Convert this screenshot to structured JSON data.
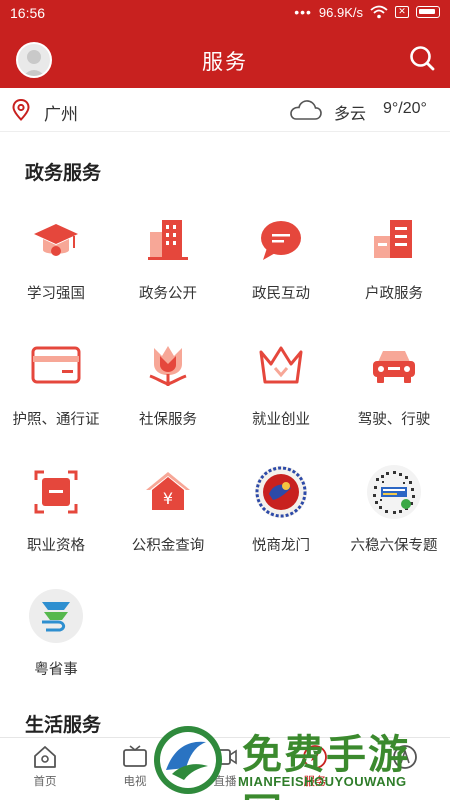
{
  "status": {
    "time": "16:56",
    "dots": "•••",
    "speed": "96.9K/s",
    "sim": "✕"
  },
  "header": {
    "title": "服务"
  },
  "location": {
    "city": "广州",
    "condition": "多云",
    "temperature": "9°/20°"
  },
  "sections": {
    "gov_title": "政务服务",
    "life_title": "生活服务"
  },
  "services": [
    {
      "label": "学习强国",
      "icon": "graduation-cap-icon"
    },
    {
      "label": "政务公开",
      "icon": "building-icon"
    },
    {
      "label": "政民互动",
      "icon": "chat-bubble-icon"
    },
    {
      "label": "户政服务",
      "icon": "houses-icon"
    },
    {
      "label": "护照、通行证",
      "icon": "passport-card-icon"
    },
    {
      "label": "社保服务",
      "icon": "tulip-icon"
    },
    {
      "label": "就业创业",
      "icon": "crown-icon"
    },
    {
      "label": "驾驶、行驶",
      "icon": "car-icon"
    },
    {
      "label": "职业资格",
      "icon": "certificate-icon"
    },
    {
      "label": "公积金查询",
      "icon": "yuan-house-icon"
    },
    {
      "label": "悦商龙门",
      "icon": "yueshang-logo-icon"
    },
    {
      "label": "六稳六保专题",
      "icon": "qr-code-icon"
    },
    {
      "label": "粤省事",
      "icon": "yueshengshi-logo-icon"
    }
  ],
  "nav": [
    {
      "label": "首页",
      "icon": "home-icon"
    },
    {
      "label": "电视",
      "icon": "tv-icon"
    },
    {
      "label": "直播",
      "icon": "live-video-icon"
    },
    {
      "label": "服务",
      "icon": "compass-icon"
    },
    {
      "label": "",
      "icon": "profile-icon"
    }
  ],
  "watermark": {
    "text": "免费手游网",
    "url": "MIANFEISHOUYOUWANG"
  },
  "colors": {
    "brand_red": "#c8211f",
    "icon_red": "#e5473c",
    "icon_light": "#f8b4a8"
  }
}
